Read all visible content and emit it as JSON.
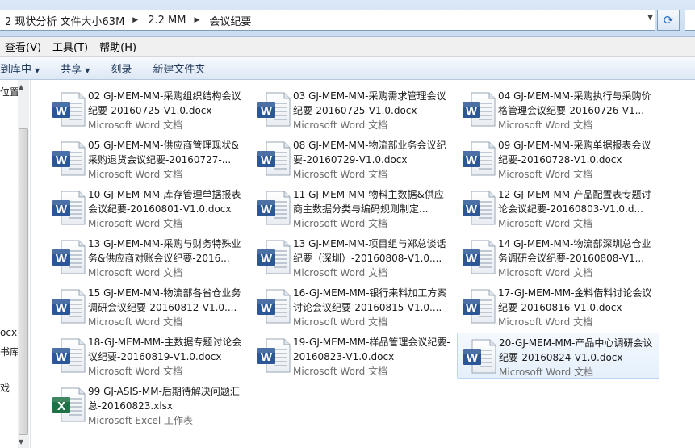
{
  "address": {
    "crumbs": [
      "2 现状分析 文件大小63M",
      "2.2 MM",
      "会议纪要"
    ]
  },
  "menu": [
    "查看(V)",
    "工具(T)",
    "帮助(H)"
  ],
  "toolbar": {
    "include_label": "到库中",
    "share_label": "共享",
    "burn_label": "刻录",
    "new_folder_label": "新建文件夹"
  },
  "nav": {
    "labels": [
      "位置",
      "ocx",
      "书库",
      "戏"
    ]
  },
  "files": [
    {
      "name": "02 GJ-MEM-MM-采购组织结构会议纪要-20160725-V1.0.docx",
      "type": "Microsoft Word 文档",
      "kind": "word"
    },
    {
      "name": "03 GJ-MEM-MM-采购需求管理会议纪要-20160725-V1.0.docx",
      "type": "Microsoft Word 文档",
      "kind": "word"
    },
    {
      "name": "04 GJ-MEM-MM-采购执行与采购价格管理会议纪要-20160726-V1...",
      "type": "Microsoft Word 文档",
      "kind": "word"
    },
    {
      "name": "05 GJ-MEM-MM-供应商管理现状&采购退货会议纪要-20160727-...",
      "type": "Microsoft Word 文档",
      "kind": "word"
    },
    {
      "name": "08 GJ-MEM-MM-物流部业务会议纪要-20160729-V1.0.docx",
      "type": "Microsoft Word 文档",
      "kind": "word"
    },
    {
      "name": "09 GJ-MEM-MM-采购单据报表会议纪要-20160728-V1.0.docx",
      "type": "Microsoft Word 文档",
      "kind": "word"
    },
    {
      "name": "10 GJ-MEM-MM-库存管理单据报表会议纪要-20160801-V1.0.docx",
      "type": "Microsoft Word 文档",
      "kind": "word"
    },
    {
      "name": "11 GJ-MEM-MM-物料主数据&供应商主数据分类与编码规则制定...",
      "type": "Microsoft Word 文档",
      "kind": "word"
    },
    {
      "name": "12 GJ-MEM-MM-产品配置表专题讨论会议纪要-20160803-V1.0.d...",
      "type": "Microsoft Word 文档",
      "kind": "word"
    },
    {
      "name": "13 GJ-MEM-MM-采购与财务特殊业务&供应商对账会议纪要-2016...",
      "type": "Microsoft Word 文档",
      "kind": "word"
    },
    {
      "name": "13 GJ-MEM-MM-项目组与郑总谈话纪要（深圳）-20160808-V1.0....",
      "type": "Microsoft Word 文档",
      "kind": "word"
    },
    {
      "name": "14 GJ-MEM-MM-物流部深圳总仓业务调研会议纪要-20160808-V1...",
      "type": "Microsoft Word 文档",
      "kind": "word"
    },
    {
      "name": "15 GJ-MEM-MM-物流部各省仓业务调研会议纪要-20160812-V1.0....",
      "type": "Microsoft Word 文档",
      "kind": "word"
    },
    {
      "name": "16-GJ-MEM-MM-银行来料加工方案讨论会议纪要-20160815-V1.0....",
      "type": "Microsoft Word 文档",
      "kind": "word"
    },
    {
      "name": "17-GJ-MEM-MM-金料借料讨论会议纪要-20160816-V1.0.docx",
      "type": "Microsoft Word 文档",
      "kind": "word"
    },
    {
      "name": "18-GJ-MEM-MM-主数据专题讨论会议纪要-20160819-V1.0.docx",
      "type": "Microsoft Word 文档",
      "kind": "word"
    },
    {
      "name": "19-GJ-MEM-MM-样品管理会议纪要-20160823-V1.0.docx",
      "type": "Microsoft Word 文档",
      "kind": "word"
    },
    {
      "name": "20-GJ-MEM-MM-产品中心调研会议纪要-20160824-V1.0.docx",
      "type": "Microsoft Word 文档",
      "kind": "word",
      "selected": true
    },
    {
      "name": "99 GJ-ASIS-MM-后期待解决问题汇总-20160823.xlsx",
      "type": "Microsoft Excel 工作表",
      "kind": "excel"
    }
  ],
  "colors": {
    "word_blue": "#2b5797",
    "excel_green": "#1e7145",
    "selection_border": "#b8d6fb"
  }
}
